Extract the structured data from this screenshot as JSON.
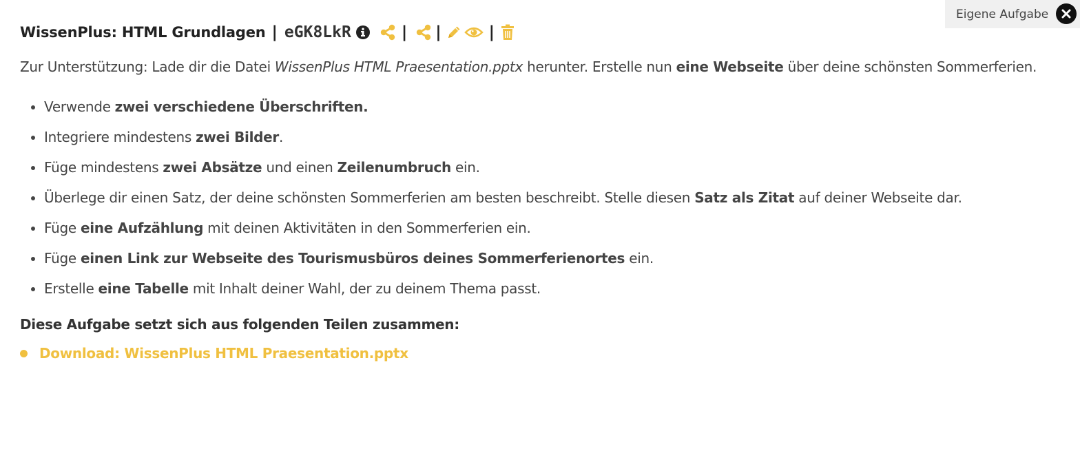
{
  "tag": {
    "label": "Eigene Aufgabe"
  },
  "header": {
    "title": "WissenPlus: HTML Grundlagen",
    "separator": "|",
    "code": "eGK8LkR"
  },
  "icons": {
    "info": "info-circle-icon",
    "share": "share-icon",
    "edit": "pencil-icon",
    "view": "eye-icon",
    "delete": "trash-icon",
    "close": "close-icon"
  },
  "colors": {
    "accent": "#f0c040",
    "text": "#444444",
    "tag_bg": "#f0f0f0"
  },
  "intro": {
    "t1": "Zur Unterstützung: Lade dir die Datei ",
    "file": "WissenPlus HTML Praesentation.pptx",
    "t2": " herunter. Erstelle nun ",
    "bold": "eine Webseite",
    "t3": " über deine schönsten Sommerferien."
  },
  "tasks": [
    {
      "p1": "Verwende ",
      "b1": "zwei verschiedene Überschriften.",
      "p2": "",
      "b2": "",
      "p3": ""
    },
    {
      "p1": "Integriere mindestens ",
      "b1": "zwei Bilder",
      "p2": ".",
      "b2": "",
      "p3": ""
    },
    {
      "p1": "Füge mindestens ",
      "b1": "zwei Absätze",
      "p2": " und einen ",
      "b2": "Zeilenumbruch",
      "p3": " ein."
    },
    {
      "p1": "Überlege dir einen Satz, der deine schönsten Sommerferien am besten beschreibt. Stelle diesen ",
      "b1": "Satz als Zitat",
      "p2": " auf deiner Webseite dar.",
      "b2": "",
      "p3": ""
    },
    {
      "p1": "Füge ",
      "b1": "eine Aufzählung",
      "p2": " mit deinen Aktivitäten in den Sommerferien ein.",
      "b2": "",
      "p3": ""
    },
    {
      "p1": "Füge ",
      "b1": "einen Link zur Webseite des Tourismusbüros deines Sommerferienortes",
      "p2": " ein.",
      "b2": "",
      "p3": ""
    },
    {
      "p1": "Erstelle ",
      "b1": "eine Tabelle",
      "p2": " mit Inhalt deiner Wahl, der zu deinem Thema passt.",
      "b2": "",
      "p3": ""
    }
  ],
  "parts": {
    "heading": "Diese Aufgabe setzt sich aus folgenden Teilen zusammen:",
    "items": [
      {
        "label": "Download: WissenPlus HTML Praesentation.pptx"
      }
    ]
  }
}
